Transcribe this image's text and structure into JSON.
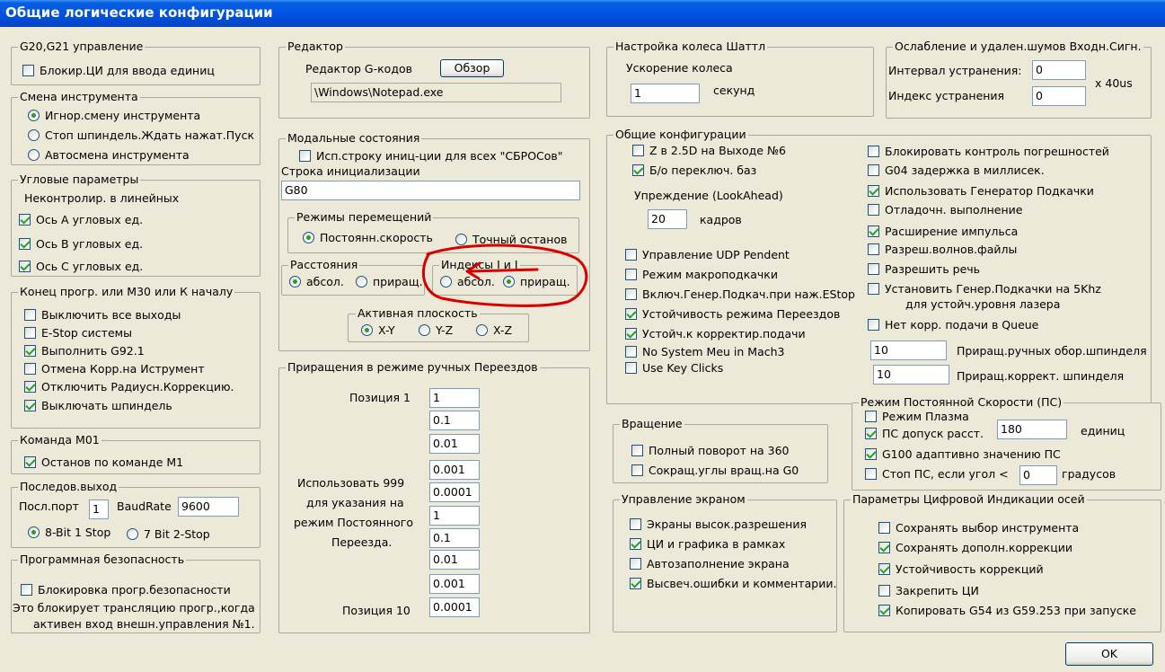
{
  "window": {
    "title": "Общие логические конфигурации"
  },
  "g20": {
    "title": "G20,G21 управление",
    "lock": "Блокир.ЦИ для ввода единиц"
  },
  "tool": {
    "title": "Смена инструмента",
    "opt1": "Игнор.смену инструмента",
    "opt2": "Стоп шпиндель.Ждать нажат.Пуск",
    "opt3": "Автосмена инструмента"
  },
  "angular": {
    "title": "Угловые параметры",
    "note": "Неконтролир. в линейных",
    "a": "Ось А угловых ед.",
    "b": "Ось В угловых ед.",
    "c": "Ось С угловых ед."
  },
  "endprog": {
    "title": "Конец прогр. или M30 или К началу",
    "items": [
      {
        "label": "Выключить все выходы",
        "checked": false
      },
      {
        "label": "E-Stop системы",
        "checked": false
      },
      {
        "label": "Выполнить G92.1",
        "checked": true
      },
      {
        "label": "Отмена Корр.на Иструмент",
        "checked": false
      },
      {
        "label": "Отключить Радиусн.Коррекцию.",
        "checked": true
      },
      {
        "label": "Выключать шпиндель",
        "checked": true
      }
    ]
  },
  "m01": {
    "title": "Команда M01",
    "stop": "Останов по команде M1"
  },
  "serial": {
    "title": "Последов.выход",
    "port_label": "Посл.порт",
    "port_value": "1",
    "baud_label": "BaudRate",
    "baud_value": "9600",
    "opt1": "8-Bit 1 Stop",
    "opt2": "7 Bit 2-Stop"
  },
  "safety": {
    "title": "Программная безопасность",
    "lock": "Блокировка прогр.безопасности",
    "note1": "Это блокирует трансляцию прогр.,когда",
    "note2": "активен вход внешн.управления №1."
  },
  "editor": {
    "title": "Редактор",
    "label": "Редактор G-кодов",
    "browse": "Обзор",
    "path": "\\Windows\\Notepad.exe"
  },
  "modal": {
    "title": "Модальные состояния",
    "use_init": "Исп.строку иниц-ции для всех \"СБРОСов\"",
    "init_label": "Строка инициализации",
    "init_value": "G80",
    "motion_title": "Режимы перемещений",
    "const_speed": "Постоянн.скорость",
    "exact_stop": "Точный останов",
    "dist_title": "Расстояния",
    "abs": "абсол.",
    "inc": "приращ.",
    "ij_title": "Индексы I и J",
    "ij_abs": "абсол.",
    "ij_inc": "приращ.",
    "plane_title": "Активная плоскость",
    "xy": "X-Y",
    "yz": "Y-Z",
    "xz": "X-Z"
  },
  "jog": {
    "title": "Приращения в режиме ручных Переездов",
    "pos1": "Позиция 1",
    "use999_1": "Использовать 999",
    "use999_2": "для указания на",
    "use999_3": "режим Постоянного",
    "use999_4": "Переезда.",
    "pos10": "Позиция 10",
    "values": [
      "1",
      "0.1",
      "0.01",
      "0.001",
      "0.0001",
      "1",
      "0.1",
      "0.01",
      "0.001",
      "0.0001"
    ]
  },
  "shuttle": {
    "title": "Настройка колеса Шаттл",
    "accel": "Ускорение колеса",
    "value": "1",
    "unit": "секунд"
  },
  "debounce": {
    "title": "Ослабление и удален.шумов Входн.Сигн.",
    "interval": "Интервал устранения:",
    "interval_value": "0",
    "index": "Индекс устранения",
    "index_value": "0",
    "unit": "x 40us"
  },
  "general": {
    "title": "Общие конфигурации",
    "z25d": "Z в 2.5D на Выходе №6",
    "nobase": "Б/о переключ. баз",
    "lookahead_label": "Упреждение (LookAhead)",
    "lookahead_value": "20",
    "lookahead_unit": "кадров",
    "left_items": [
      {
        "label": "Управление UDP Pendent",
        "checked": false
      },
      {
        "label": "Режим макроподкачки",
        "checked": false
      },
      {
        "label": "Включ.Генер.Подкач.при наж.EStop",
        "checked": false
      },
      {
        "label": "Устойчивость режима Переездов",
        "checked": true
      },
      {
        "label": "Устойч.к корректир.подачи",
        "checked": true
      },
      {
        "label": "No System Meu in Mach3",
        "checked": false
      },
      {
        "label": "Use Key Clicks",
        "checked": false
      }
    ],
    "right_items": [
      {
        "label": "Блокировать контроль погрешностей",
        "checked": false
      },
      {
        "label": "G04 задержка в миллисек.",
        "checked": false
      },
      {
        "label": "Использовать Генератор Подкачки",
        "checked": true
      },
      {
        "label": "Отладочн. выполнение",
        "checked": false
      },
      {
        "label": "Расширение импульса",
        "checked": true
      },
      {
        "label": "Разреш.волнов.файлы",
        "checked": false
      },
      {
        "label": "Разрешить речь",
        "checked": false
      }
    ],
    "charge5k_1": "Установить Генер.Подкачки на 5Khz",
    "charge5k_2": "для устойч.уровня лазера",
    "no_queue": "Нет корр. подачи в Queue",
    "spindle_jog_value": "10",
    "spindle_jog_label": "Приращ.ручных обор.шпинделя",
    "spindle_ovr_value": "10",
    "spindle_ovr_label": "Приращ.коррект. шпинделя"
  },
  "css": {
    "title": "Режим Постоянной Скорости (ПС)",
    "plasma": "Режим Плазма",
    "tol": "ПС допуск расст.",
    "tol_value": "180",
    "tol_unit": "единиц",
    "g100": "G100 адаптивно значению ПС",
    "stop": "Стоп ПС, если угол <",
    "stop_value": "0",
    "stop_unit": "градусов"
  },
  "rotation": {
    "title": "Вращение",
    "full": "Полный поворот на 360",
    "short": "Сокращ.углы вращ.на G0"
  },
  "screen": {
    "title": "Управление экраном",
    "items": [
      {
        "label": "Экраны высок.разрешения",
        "checked": false
      },
      {
        "label": "ЦИ и графика в рамках",
        "checked": true
      },
      {
        "label": "Автозаполнение экрана",
        "checked": false
      },
      {
        "label": "Высвеч.ошибки и комментарии.",
        "checked": true
      }
    ]
  },
  "dro": {
    "title": "Параметры Цифровой Индикации осей",
    "items": [
      {
        "label": "Сохранять выбор инструмента",
        "checked": false
      },
      {
        "label": "Сохранять дополн.коррекции",
        "checked": true
      },
      {
        "label": "Устойчивость коррекций",
        "checked": true
      },
      {
        "label": "Закрепить ЦИ",
        "checked": false
      },
      {
        "label": "Копировать G54 из G59.253 при запуске",
        "checked": true
      }
    ]
  },
  "ok": "OK",
  "colors": {
    "title_bar": "#0054e3",
    "window_bg": "#ece9d8",
    "check": "#21a121",
    "annotation": "#d90000"
  }
}
